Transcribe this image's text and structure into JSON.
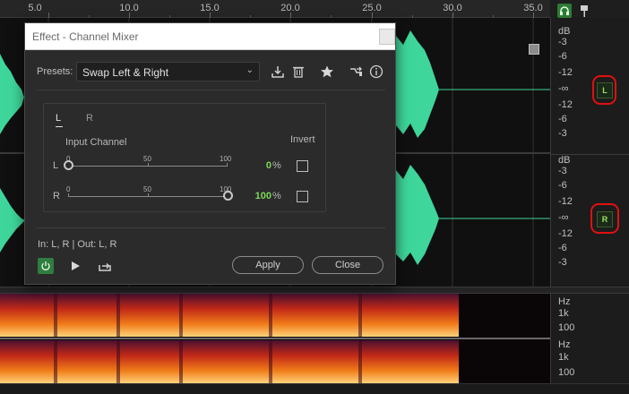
{
  "ruler": {
    "ticks": [
      "5.0",
      "10.0",
      "15.0",
      "20.0",
      "25.0",
      "30.0",
      "35.0"
    ]
  },
  "db_scale": {
    "top": [
      "dB",
      "-3",
      "-6",
      "-12",
      "-∞",
      "-12",
      "-6",
      "-3"
    ],
    "bottom": [
      "dB",
      "-3",
      "-6",
      "-12",
      "-∞",
      "-12",
      "-6",
      "-3"
    ]
  },
  "channel_buttons": {
    "left": "L",
    "right": "R"
  },
  "hz_scale": {
    "top": [
      "Hz",
      "1k",
      "100"
    ],
    "bottom": [
      "Hz",
      "1k",
      "100"
    ]
  },
  "colors": {
    "waveform": "#3ed69a",
    "accent_green": "#7ed957",
    "annotation_red": "#e01010"
  },
  "dialog": {
    "title": "Effect - Channel Mixer",
    "presets_label": "Presets:",
    "preset_value": "Swap Left & Right",
    "tabs": [
      "L",
      "R"
    ],
    "active_tab": "L",
    "input_channel_label": "Input Channel",
    "invert_label": "Invert",
    "rows": [
      {
        "label": "L",
        "scale": [
          "0",
          "50",
          "100"
        ],
        "value": "0",
        "unit": "%",
        "slider_fraction": 0.0,
        "invert": false
      },
      {
        "label": "R",
        "scale": [
          "0",
          "50",
          "100"
        ],
        "value": "100",
        "unit": "%",
        "slider_fraction": 1.0,
        "invert": false
      }
    ],
    "routing": "In: L, R | Out: L, R",
    "apply_label": "Apply",
    "close_label": "Close"
  },
  "icons": {
    "toolbar": [
      "save-preset-icon",
      "delete-preset-icon",
      "favorite-star-icon",
      "routing-icon",
      "info-icon"
    ],
    "footer": [
      "power-icon",
      "play-icon",
      "loop-export-icon"
    ],
    "top_right": [
      "headphones-icon",
      "pin-icon"
    ]
  }
}
